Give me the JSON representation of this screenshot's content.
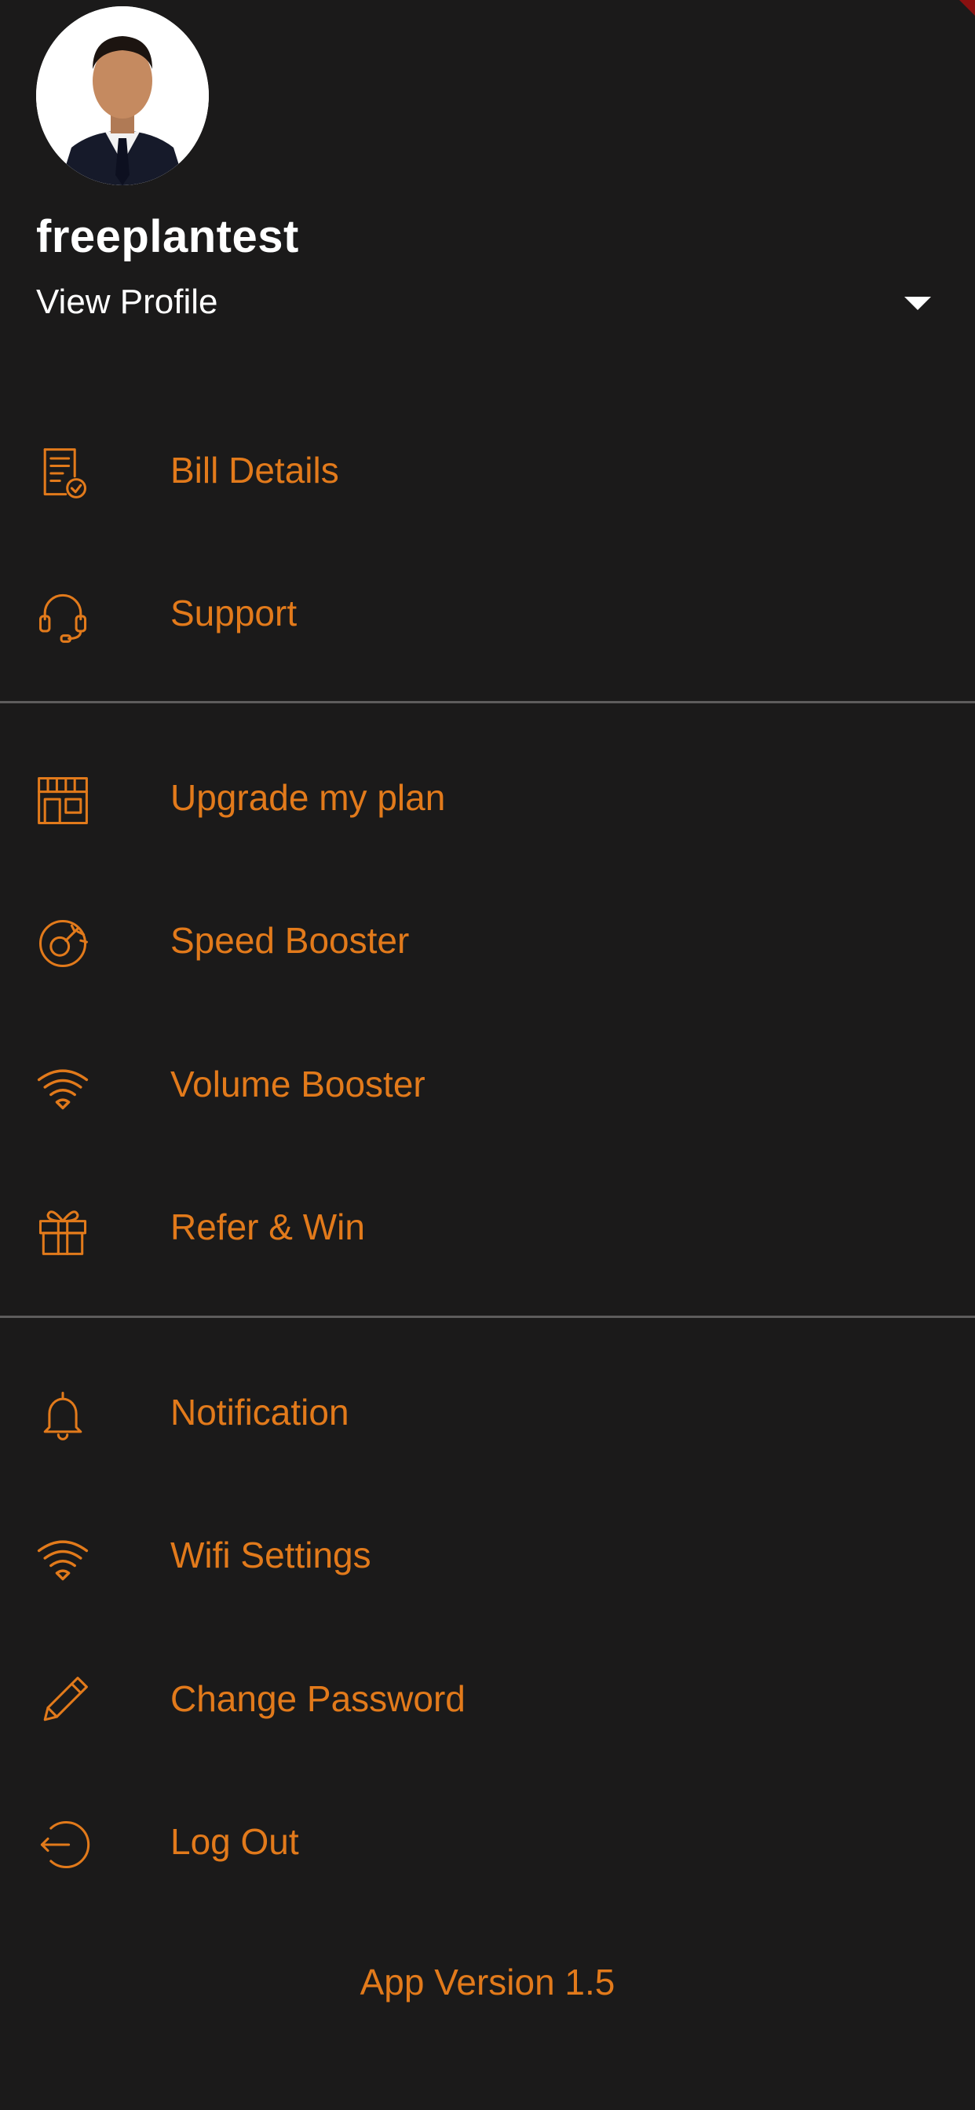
{
  "profile": {
    "username": "freeplantest",
    "view_profile_label": "View Profile"
  },
  "colors": {
    "background": "#1b1a1a",
    "accent": "#e27a1b",
    "text_primary": "#ffffff",
    "divider": "#5e5c5c"
  },
  "menu": {
    "groups": [
      {
        "items": [
          {
            "label": "Bill Details",
            "icon": "bill-icon"
          },
          {
            "label": "Support",
            "icon": "headset-icon"
          }
        ]
      },
      {
        "items": [
          {
            "label": "Upgrade my plan",
            "icon": "store-icon"
          },
          {
            "label": "Speed Booster",
            "icon": "speedometer-icon"
          },
          {
            "label": "Volume Booster",
            "icon": "wifi-icon"
          },
          {
            "label": "Refer & Win",
            "icon": "gift-icon"
          }
        ]
      },
      {
        "items": [
          {
            "label": "Notification",
            "icon": "bell-icon"
          },
          {
            "label": "Wifi Settings",
            "icon": "wifi-icon"
          },
          {
            "label": "Change Password",
            "icon": "pencil-icon"
          },
          {
            "label": "Log Out",
            "icon": "logout-icon"
          }
        ]
      }
    ]
  },
  "footer": {
    "app_version": "App Version  1.5"
  }
}
